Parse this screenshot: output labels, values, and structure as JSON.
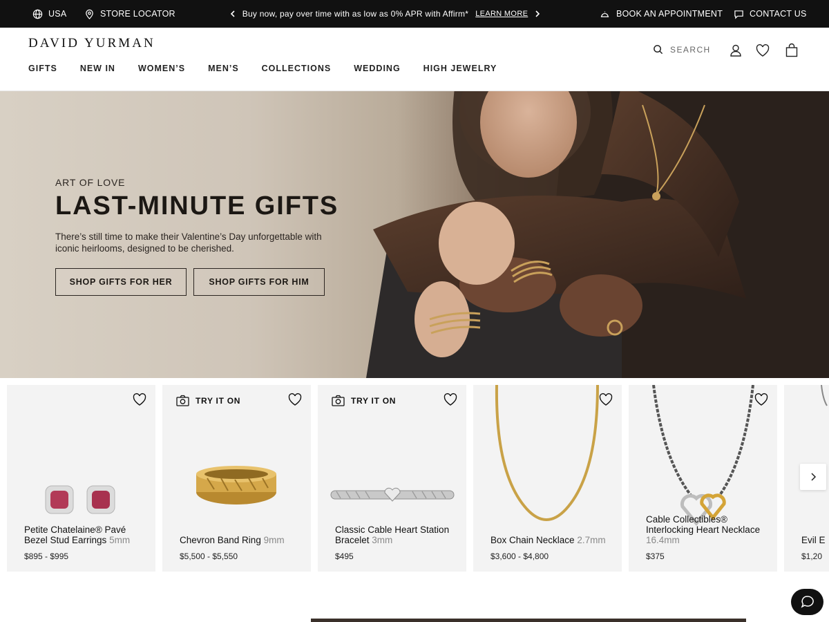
{
  "topbar": {
    "region": "USA",
    "store_locator": "STORE LOCATOR",
    "promo_text": "Buy now, pay over time with as low as 0% APR with Affirm*",
    "promo_link": "LEARN MORE",
    "book_appointment": "BOOK AN APPOINTMENT",
    "contact_us": "CONTACT US"
  },
  "header": {
    "logo": "DAVID YURMAN",
    "search_placeholder": "SEARCH",
    "nav": [
      "GIFTS",
      "NEW IN",
      "WOMEN’S",
      "MEN’S",
      "COLLECTIONS",
      "WEDDING",
      "HIGH JEWELRY"
    ]
  },
  "hero": {
    "eyebrow": "ART OF LOVE",
    "title": "LAST-MINUTE GIFTS",
    "description": "There’s still time to make their Valentine’s Day unforgettable with iconic heirlooms, designed to be cherished.",
    "cta_her": "SHOP GIFTS FOR HER",
    "cta_him": "SHOP GIFTS FOR HIM"
  },
  "products": [
    {
      "name": "Petite Chatelaine® Pavé Bezel Stud Earrings",
      "size": "5mm",
      "price": "$895 - $995",
      "try_on": ""
    },
    {
      "name": "Chevron Band Ring",
      "size": "9mm",
      "price": "$5,500 - $5,550",
      "try_on": "TRY IT ON"
    },
    {
      "name": "Classic Cable Heart Station Bracelet",
      "size": "3mm",
      "price": "$495",
      "try_on": "TRY IT ON"
    },
    {
      "name": "Box Chain Necklace",
      "size": "2.7mm",
      "price": "$3,600 - $4,800",
      "try_on": ""
    },
    {
      "name": "Cable Collectibles® Interlocking Heart Necklace",
      "size": "16.4mm",
      "price": "$375",
      "try_on": ""
    },
    {
      "name": "Evil E",
      "size": "",
      "price": "$1,20",
      "try_on": ""
    }
  ],
  "colors": {
    "topbar": "#111111",
    "text": "#111111",
    "card_bg": "#f3f3f3",
    "size_text": "#888888"
  }
}
